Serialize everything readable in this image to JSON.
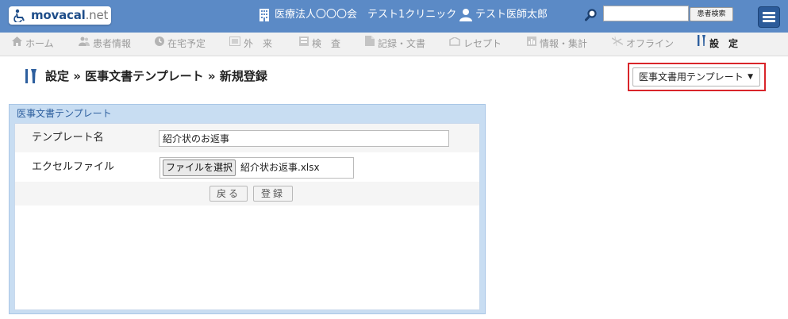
{
  "header": {
    "logo": "movacal.net",
    "logo_main": "movacal",
    "logo_tld": ".net",
    "organization": "医療法人〇〇〇会　テスト1クリニック",
    "user": "テスト医師太郎",
    "search": {
      "value": "",
      "button_label": "患者検索"
    },
    "icons": [
      "building-icon",
      "user-icon",
      "search-icon",
      "hamburger-menu-icon"
    ]
  },
  "nav": {
    "items": [
      {
        "label": "ホーム",
        "icon": "home-icon"
      },
      {
        "label": "患者情報",
        "icon": "patients-icon"
      },
      {
        "label": "在宅予定",
        "icon": "clock-icon"
      },
      {
        "label": "外　来",
        "icon": "outpatient-icon"
      },
      {
        "label": "検　査",
        "icon": "examination-icon"
      },
      {
        "label": "記録・文書",
        "icon": "document-icon"
      },
      {
        "label": "レセプト",
        "icon": "receipt-icon"
      },
      {
        "label": "情報・集計",
        "icon": "stats-icon"
      },
      {
        "label": "オフライン",
        "icon": "offline-icon"
      },
      {
        "label": "設　定",
        "icon": "settings-icon",
        "active": true
      }
    ]
  },
  "page": {
    "breadcrumb": "設定 » 医事文書テンプレート » 新規登録",
    "template_type_select": "医事文書用テンプレート",
    "highlight_color": "#d9252a"
  },
  "form": {
    "panel_title": "医事文書テンプレート",
    "template_name_label": "テンプレート名",
    "template_name_value": "紹介状のお返事",
    "excel_file_label": "エクセルファイル",
    "file_button_label": "ファイルを選択",
    "file_name": "紹介状お返事.xlsx",
    "back_button": "戻る",
    "register_button": "登録"
  },
  "colors": {
    "header_bg": "#5b8ac6",
    "panel_bg": "#c8ddf2",
    "nav_bg": "#f1f1f1"
  }
}
